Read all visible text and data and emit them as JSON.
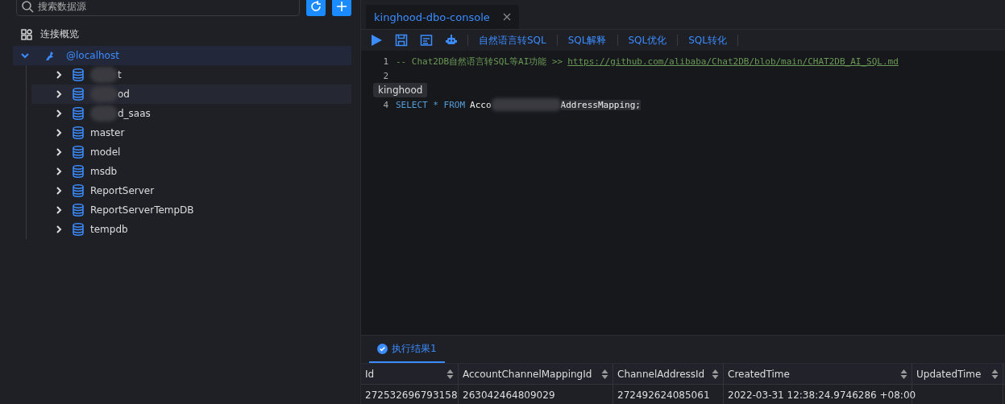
{
  "sidebar": {
    "search": {
      "placeholder": "搜索数据源"
    },
    "overview": "连接概览",
    "tree": [
      {
        "label": "@localhost",
        "kind": "connection",
        "expanded": true,
        "selected": true,
        "children": [
          {
            "label": "t",
            "kind": "database",
            "blurred": true,
            "expanded": false,
            "selected": false,
            "hovered": false
          },
          {
            "label": "od",
            "kind": "database",
            "blurred": true,
            "expanded": false,
            "selected": false,
            "hovered": true
          },
          {
            "label": "d_saas",
            "kind": "database",
            "blurred": true,
            "expanded": false,
            "selected": false,
            "hovered": false
          },
          {
            "label": "master",
            "kind": "database",
            "blurred": false,
            "expanded": false,
            "selected": false,
            "hovered": false
          },
          {
            "label": "model",
            "kind": "database",
            "blurred": false,
            "expanded": false,
            "selected": false,
            "hovered": false
          },
          {
            "label": "msdb",
            "kind": "database",
            "blurred": false,
            "expanded": false,
            "selected": false,
            "hovered": false
          },
          {
            "label": "ReportServer",
            "kind": "database",
            "blurred": false,
            "expanded": false,
            "selected": false,
            "hovered": false
          },
          {
            "label": "ReportServerTempDB",
            "kind": "database",
            "blurred": false,
            "expanded": false,
            "selected": false,
            "hovered": false
          },
          {
            "label": "tempdb",
            "kind": "database",
            "blurred": false,
            "expanded": false,
            "selected": false,
            "hovered": false
          }
        ]
      }
    ]
  },
  "tooltip": "kinghood",
  "editor_tabs": [
    {
      "label": "kinghood-dbo-console",
      "selected": true
    }
  ],
  "toolbar": {
    "actions": [
      "自然语言转SQL",
      "SQL解释",
      "SQL优化",
      "SQL转化"
    ]
  },
  "editor": {
    "lines": [
      {
        "number": "1",
        "kind": "comment",
        "text": "-- Chat2DB自然语言转SQL等AI功能 >>",
        "link": "https://github.com/alibaba/Chat2DB/blob/main/CHAT2DB_AI_SQL.md"
      },
      {
        "number": "2",
        "kind": "empty"
      },
      {
        "kind": "hidden"
      },
      {
        "number": "4",
        "kind": "sql",
        "keywords": "SELECT * FROM",
        "before": "Acco",
        "after": "AddressMapping;"
      }
    ]
  },
  "results": {
    "tabs": [
      {
        "label": "执行结果1",
        "selected": true
      }
    ],
    "columns": [
      "Id",
      "AccountChannelMappingId",
      "ChannelAddressId",
      "CreatedTime",
      "UpdatedTime"
    ],
    "rows": [
      [
        "272532696793158",
        "263042464809029",
        "272492624085061",
        "2022-03-31 12:38:24.9746286 +08:00",
        ""
      ]
    ]
  }
}
